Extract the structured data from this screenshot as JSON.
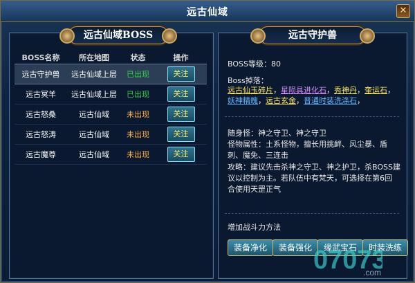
{
  "window": {
    "title": "远古仙域",
    "close_icon": "✕"
  },
  "left_banner": "远古仙域BOSS",
  "right_banner": "远古守护兽",
  "table": {
    "headers": [
      "BOSS名称",
      "所在地图",
      "状态",
      "操作"
    ],
    "rows": [
      {
        "name": "远古守护兽",
        "map": "远古仙域上层",
        "status": "已出现",
        "button": "关注"
      },
      {
        "name": "远古冥羊",
        "map": "远古仙域上层",
        "status": "已出现",
        "button": "关注"
      },
      {
        "name": "远古怒桑",
        "map": "远古仙域",
        "status": "未出现",
        "button": "关注"
      },
      {
        "name": "远古怒涛",
        "map": "远古仙域",
        "status": "未出现",
        "button": "关注"
      },
      {
        "name": "远古魔尊",
        "map": "远古仙域",
        "status": "未出现",
        "button": "关注"
      }
    ]
  },
  "details": {
    "level": "BOSS等级：80",
    "drops_title": "Boss掉落：",
    "drops": [
      {
        "text": "远古仙玉碎片",
        "color": "#ffe95d"
      },
      {
        "text": "星陨具进化石",
        "color": "#d78fff"
      },
      {
        "text": "秀神丹",
        "color": "#ffe95d"
      },
      {
        "text": "奎运石",
        "color": "#ffe95d"
      },
      {
        "text": "妖神精魄",
        "color": "#63b8ff"
      },
      {
        "text": "远古玄金",
        "color": "#ffe95d"
      },
      {
        "text": "普通时装洗涤石",
        "color": "#63b8ff"
      }
    ],
    "follow": "随身怪：神之守卫、神之守卫",
    "attributes_1": "怪物属性：土系怪物，擅长用挑衅、风尘暴、盾",
    "attributes_2": "刺、魔免、三连击",
    "strategy_1": "攻略：建议先击杀神之守卫、神之护卫，杀BOSS建",
    "strategy_2": "议以控制为主。若队伍中有梵天，可选择在第6回",
    "strategy_3": "合使用天罡正气",
    "method_title": "增加战斗力方法",
    "methods": [
      "装备净化",
      "装备强化",
      "缘武宝石",
      "时装洗练"
    ]
  },
  "watermark": {
    "text": "07073",
    "domain": ".com"
  }
}
